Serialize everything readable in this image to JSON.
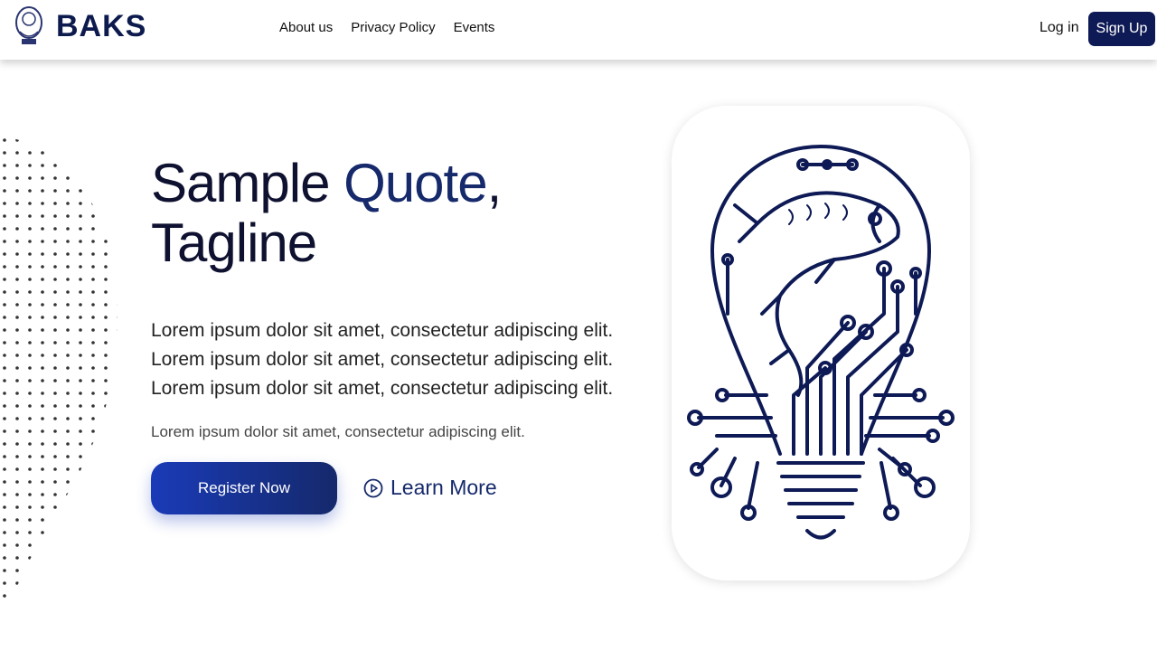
{
  "header": {
    "brand": "BAKS",
    "nav": [
      {
        "label": "About us"
      },
      {
        "label": "Privacy Policy"
      },
      {
        "label": "Events"
      }
    ],
    "login_label": "Log in",
    "signup_label": "Sign Up"
  },
  "hero": {
    "title_part1": "Sample ",
    "title_accent": "Quote",
    "title_part2": ",",
    "title_line2": "Tagline",
    "paragraph": [
      "Lorem ipsum dolor sit amet, consectetur adipiscing elit.",
      "Lorem ipsum dolor sit amet, consectetur adipiscing elit.",
      "Lorem ipsum dolor sit amet, consectetur adipiscing elit."
    ],
    "subtext": "Lorem ipsum dolor sit amet, consectetur adipiscing elit.",
    "register_label": "Register Now",
    "learn_label": "Learn More"
  },
  "colors": {
    "brand_navy": "#0e1a55",
    "accent_blue": "#15296b",
    "button_gradient_start": "#1a3bb8"
  },
  "icons": {
    "logo": "crest-emblem-icon",
    "learn": "play-circle-icon",
    "illustration": "fish-lightbulb-circuit-illustration"
  }
}
